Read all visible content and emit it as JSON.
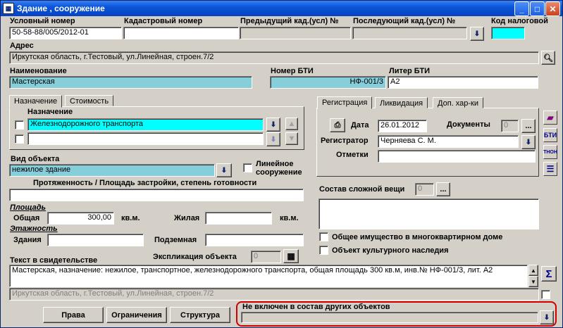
{
  "window": {
    "title": "Здание , сооружение",
    "icon": "building-app-icon",
    "min": "_",
    "max": "□",
    "close": "✕"
  },
  "top": {
    "cond_num_label": "Условный номер",
    "cond_num_value": "50-58-88/005/2012-01",
    "cad_num_label": "Кадастровый номер",
    "cad_num_value": "",
    "prev_cad_label": "Предыдущий кад.(усл) №",
    "next_cad_label": "Последующий кад.(усл) №",
    "tax_code_label": "Код налоговой"
  },
  "address": {
    "label": "Адрес",
    "value": "Иркутская область, г.Тестовый, ул.Линейная, строен.7/2"
  },
  "name": {
    "label": "Наименование",
    "value": "Мастерская",
    "bti_label": "Номер БТИ",
    "bti_value": "НФ-001/3",
    "liter_label": "Литер БТИ",
    "liter_value": "А2"
  },
  "purpose_tabs": {
    "tab1": "Назначение",
    "tab2": "Стоимость",
    "heading": "Назначение",
    "row1": "Железнодорожного транспорта",
    "row2": ""
  },
  "right_tabs": {
    "tab1": "Регистрация",
    "tab2": "Ликвидация",
    "tab3": "Доп. хар-ки"
  },
  "registration": {
    "date_label": "Дата",
    "date_value": "26.01.2012",
    "docs_label": "Документы",
    "docs_value": "0",
    "registrar_label": "Регистратор",
    "registrar_value": "Черняева С. М.",
    "marks_label": "Отметки",
    "marks_value": "",
    "more": "..."
  },
  "object_type": {
    "label": "Вид объекта",
    "value": "нежилое здание",
    "linear_label_1": "Линейное",
    "linear_label_2": "сооружение"
  },
  "extent": {
    "label": "Протяженность / Площадь застройки, степень готовности",
    "value": ""
  },
  "area": {
    "group": "Площадь",
    "total_label": "Общая",
    "total_value": "300,00",
    "unit": "кв.м.",
    "living_label": "Жилая",
    "living_value": "",
    "unit2": "кв.м."
  },
  "floors": {
    "group": "Этажность",
    "bld_label": "Здания",
    "bld_value": "",
    "under_label": "Подземная",
    "under_value": ""
  },
  "complex": {
    "label": "Состав сложной вещи",
    "value": "0",
    "more": "..."
  },
  "checks": {
    "common": "Общее имущество в многоквартирном доме",
    "heritage": "Объект культурного наследия"
  },
  "certificate": {
    "label": "Текст в свидетельстве",
    "explication_label": "Экспликация объекта",
    "explication_value": "0",
    "text": "Мастерская, назначение: нежилое, транспортное, железнодорожного транспорта, общая площадь 300 кв.м, инв.№ НФ-001/3, лит. А2",
    "addr": "Иркутская область, г.Тестовый, ул.Линейная, строен.7/2",
    "sigma": "Σ"
  },
  "buttons": {
    "rights": "Права",
    "limits": "Ограничения",
    "structure": "Структура"
  },
  "bottom": {
    "label": "Не включен в состав других объектов",
    "value": ""
  },
  "side_icons": {
    "bti": "БТИ",
    "ton": "ТНОН"
  },
  "colors": {
    "title_bar": "#0a55d8",
    "field_blue": "#87cedb",
    "cyan": "#00ffff",
    "highlight_border": "#d00000"
  }
}
